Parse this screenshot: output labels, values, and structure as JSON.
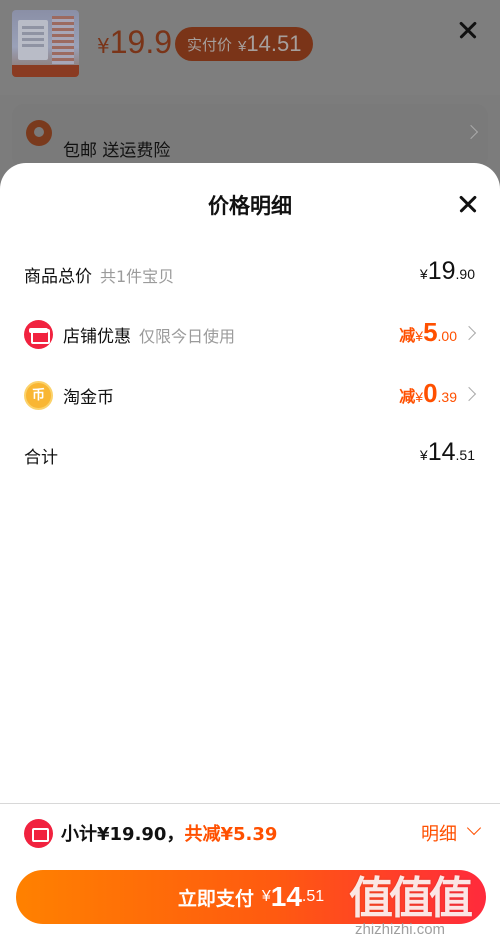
{
  "background": {
    "thumbnail_caption": "",
    "price_yen": "¥",
    "price": "19.9",
    "actual_label": "实付价",
    "actual_yen": "¥",
    "actual_int": "14",
    "actual_dec": ".51",
    "shipping_text": "包邮 送运费险"
  },
  "sheet": {
    "title": "价格明细",
    "rows": [
      {
        "label": "商品总价",
        "sub": "共1件宝贝",
        "prefix": "",
        "yen": "¥",
        "int": "19",
        "dec": ".90"
      },
      {
        "label": "店铺优惠",
        "sub": "仅限今日使用",
        "prefix": "减",
        "yen": "¥",
        "int": "5",
        "dec": ".00"
      },
      {
        "label": "淘金币",
        "sub": "",
        "prefix": "减",
        "yen": "¥",
        "int": "0",
        "dec": ".39",
        "icon_glyph": "币"
      },
      {
        "label": "合计",
        "sub": "",
        "prefix": "",
        "yen": "¥",
        "int": "14",
        "dec": ".51"
      }
    ]
  },
  "footer": {
    "subtotal_text": "小计¥19.90，",
    "discount_text": "共减¥5.39",
    "detail_label": "明细",
    "pay_label": "立即支付",
    "pay_yen": "¥",
    "pay_int": "14",
    "pay_dec": ".51"
  },
  "watermark": {
    "main": "值值值",
    "sub": "zhizhizhi.com"
  },
  "colors": {
    "accent": "#ff5000",
    "red_icon": "#f1223f",
    "coin": "#f9b633"
  }
}
